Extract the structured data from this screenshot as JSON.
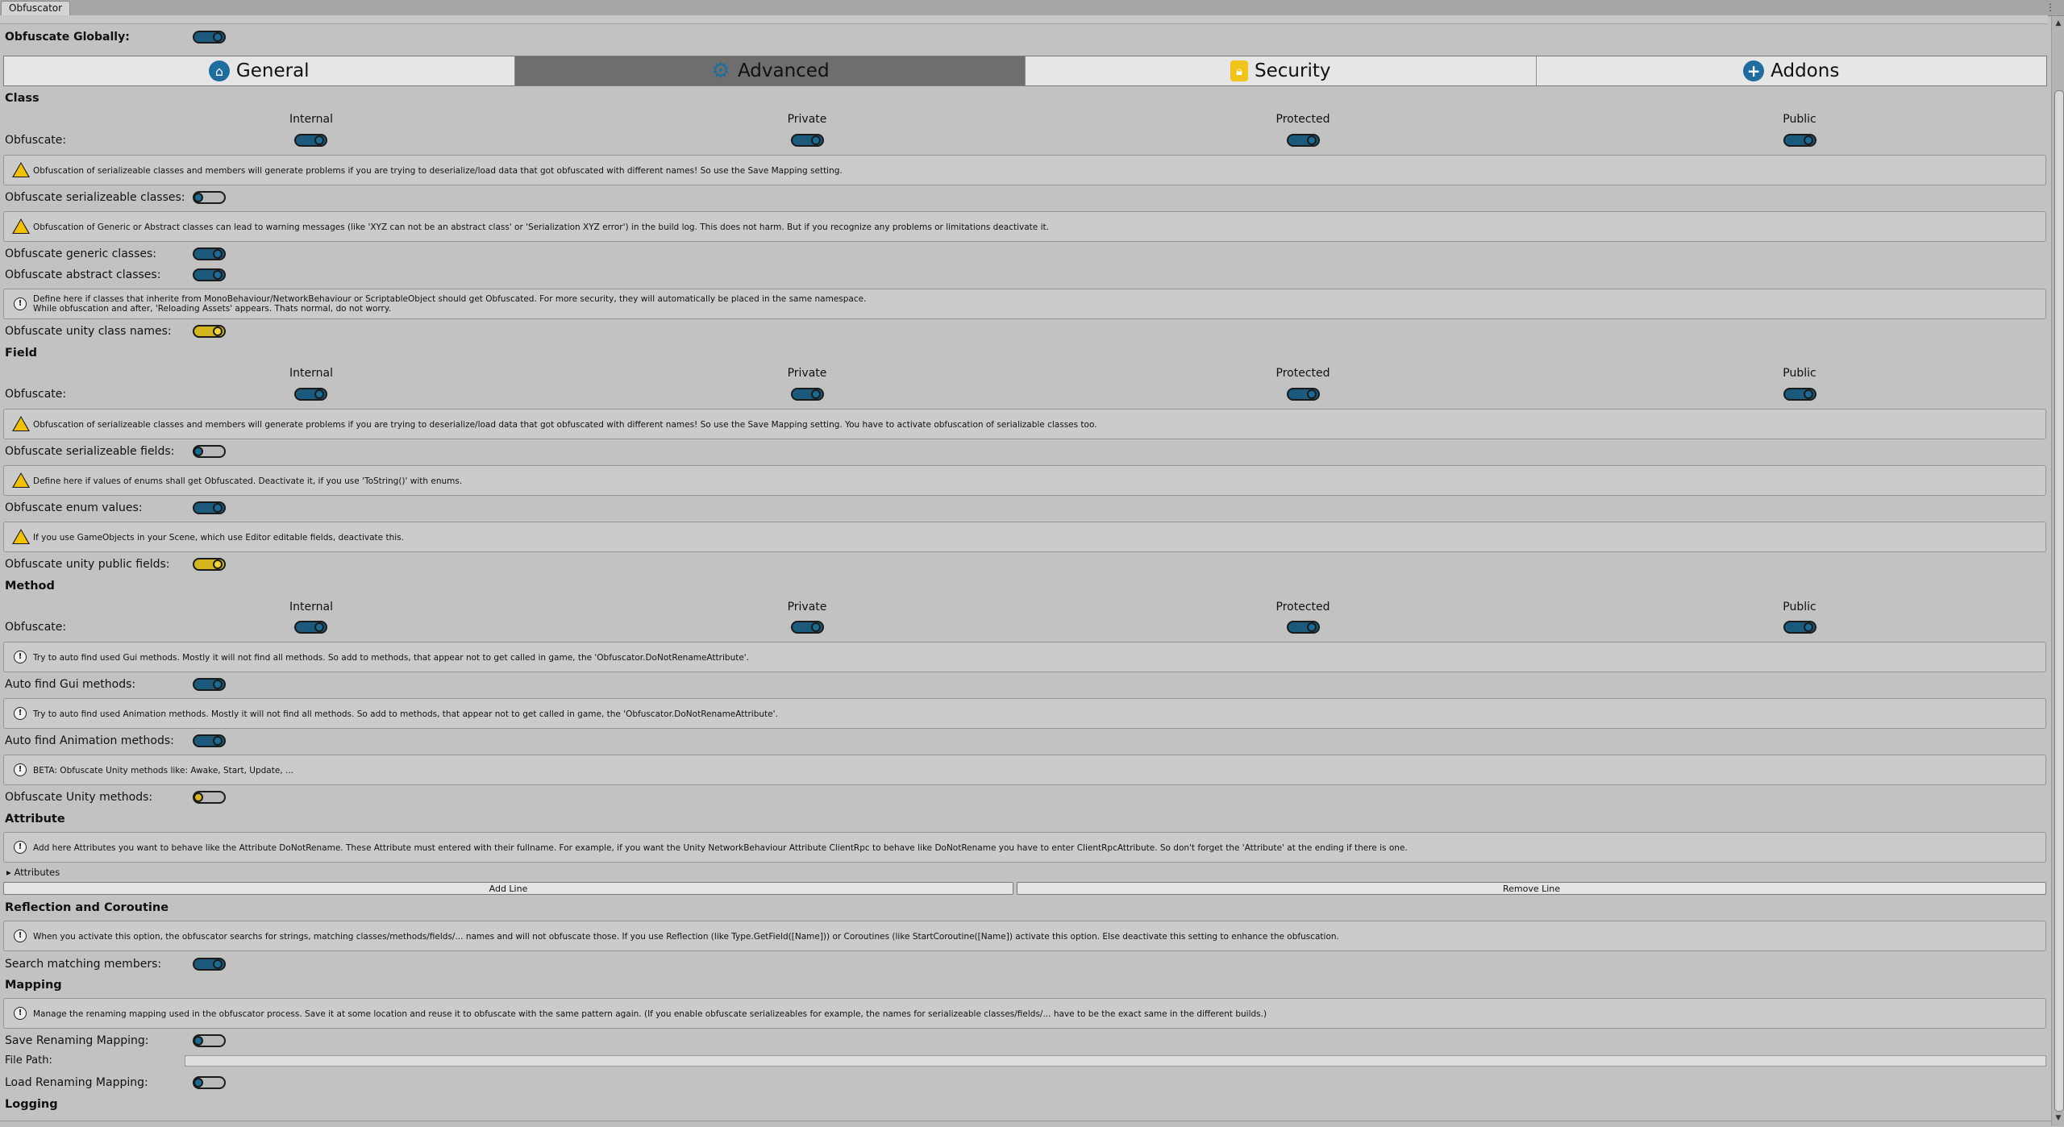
{
  "window": {
    "tab_title": "Obfuscator",
    "menu_glyph": "⋮"
  },
  "global": {
    "label": "Obfuscate Globally:",
    "enabled": true
  },
  "tabs": [
    {
      "label": "General",
      "icon": "home-icon",
      "active": false
    },
    {
      "label": "Advanced",
      "icon": "gears-icon",
      "active": true
    },
    {
      "label": "Security",
      "icon": "lock-icon",
      "active": false
    },
    {
      "label": "Addons",
      "icon": "plus-icon",
      "active": false
    }
  ],
  "access_columns": [
    "Internal",
    "Private",
    "Protected",
    "Public"
  ],
  "class": {
    "title": "Class",
    "obfuscate_label": "Obfuscate:",
    "toggles": [
      true,
      true,
      true,
      true
    ],
    "warn_serializable": "Obfuscation of serializeable classes and members will generate problems if you are trying to deserialize/load data that got obfuscated with different names! So use the Save Mapping setting.",
    "serializable_label": "Obfuscate serializeable classes:",
    "serializable": false,
    "warn_generic": "Obfuscation of Generic or Abstract classes can lead to warning messages (like 'XYZ can not be an abstract class' or 'Serialization XYZ error') in the build log. This does not harm. But if you recognize any problems or limitations deactivate it.",
    "generic_label": "Obfuscate generic classes:",
    "generic": true,
    "abstract_label": "Obfuscate abstract classes:",
    "abstract": true,
    "info_unity": "Define here if classes that inherite from MonoBehaviour/NetworkBehaviour or ScriptableObject should get Obfuscated. For more security, they will automatically be placed in the same namespace.\nWhile obfuscation and after, 'Reloading Assets' appears. Thats normal, do not worry.",
    "unity_label": "Obfuscate unity class names:",
    "unity": true
  },
  "field": {
    "title": "Field",
    "obfuscate_label": "Obfuscate:",
    "toggles": [
      true,
      true,
      true,
      true
    ],
    "warn_serializable": "Obfuscation of serializeable classes and members will generate problems if you are trying to deserialize/load data that got obfuscated with different names! So use the Save Mapping setting. You have to activate obfuscation of serializable classes too.",
    "serializable_label": "Obfuscate serializeable fields:",
    "serializable": false,
    "warn_enum": "Define here if values of enums shall get Obfuscated. Deactivate it, if you use 'ToString()' with enums.",
    "enum_label": "Obfuscate enum values:",
    "enum": true,
    "warn_public": "If you use GameObjects in your Scene, which use Editor editable fields, deactivate this.",
    "public_label": "Obfuscate unity public fields:",
    "public": true
  },
  "method": {
    "title": "Method",
    "obfuscate_label": "Obfuscate:",
    "toggles": [
      true,
      true,
      true,
      true
    ],
    "info_gui": "Try to auto find used Gui methods. Mostly it will not find all methods. So add to methods, that appear not to get called in game, the 'Obfuscator.DoNotRenameAttribute'.",
    "gui_label": "Auto find Gui methods:",
    "gui": true,
    "info_anim": "Try to auto find used Animation methods. Mostly it will not find all methods. So add to methods, that appear not to get called in game, the 'Obfuscator.DoNotRenameAttribute'.",
    "anim_label": "Auto find Animation methods:",
    "anim": true,
    "info_unity": "BETA: Obfuscate Unity methods like: Awake, Start, Update, ...",
    "unity_label": "Obfuscate Unity methods:",
    "unity": false
  },
  "attribute": {
    "title": "Attribute",
    "info": "Add here Attributes you want to behave like the Attribute DoNotRename. These Attribute must entered with their fullname. For example, if you want the Unity NetworkBehaviour Attribute ClientRpc to behave like DoNotRename you have to enter ClientRpcAttribute. So don't forget the 'Attribute' at the ending if there is one.",
    "foldout_label": "Attributes",
    "add_label": "Add Line",
    "remove_label": "Remove Line"
  },
  "reflection": {
    "title": "Reflection and Coroutine",
    "info": "When you activate this option, the obfuscator searchs for strings, matching classes/methods/fields/... names and will not obfuscate those. If you use Reflection (like Type.GetField([Name])) or Coroutines (like StartCoroutine([Name]) activate this option. Else deactivate this setting to enhance the obfuscation.",
    "search_label": "Search matching members:",
    "search": true
  },
  "mapping": {
    "title": "Mapping",
    "info": "Manage the renaming mapping used in the obfuscator process. Save it at some location and reuse it to obfuscate with the same pattern again. (If you enable obfuscate serializeables for example, the names for serializeable classes/fields/... have to be the exact same in the different builds.)",
    "save_label": "Save Renaming Mapping:",
    "save": false,
    "path_label": "File Path:",
    "path_value": "",
    "load_label": "Load Renaming Mapping:",
    "load": false
  },
  "logging": {
    "title": "Logging"
  },
  "colors": {
    "toggle_blue": "#1b6b94",
    "toggle_yellow": "#f2d33a",
    "active_tab": "#6e6e6e",
    "warning": "#f2c200"
  }
}
